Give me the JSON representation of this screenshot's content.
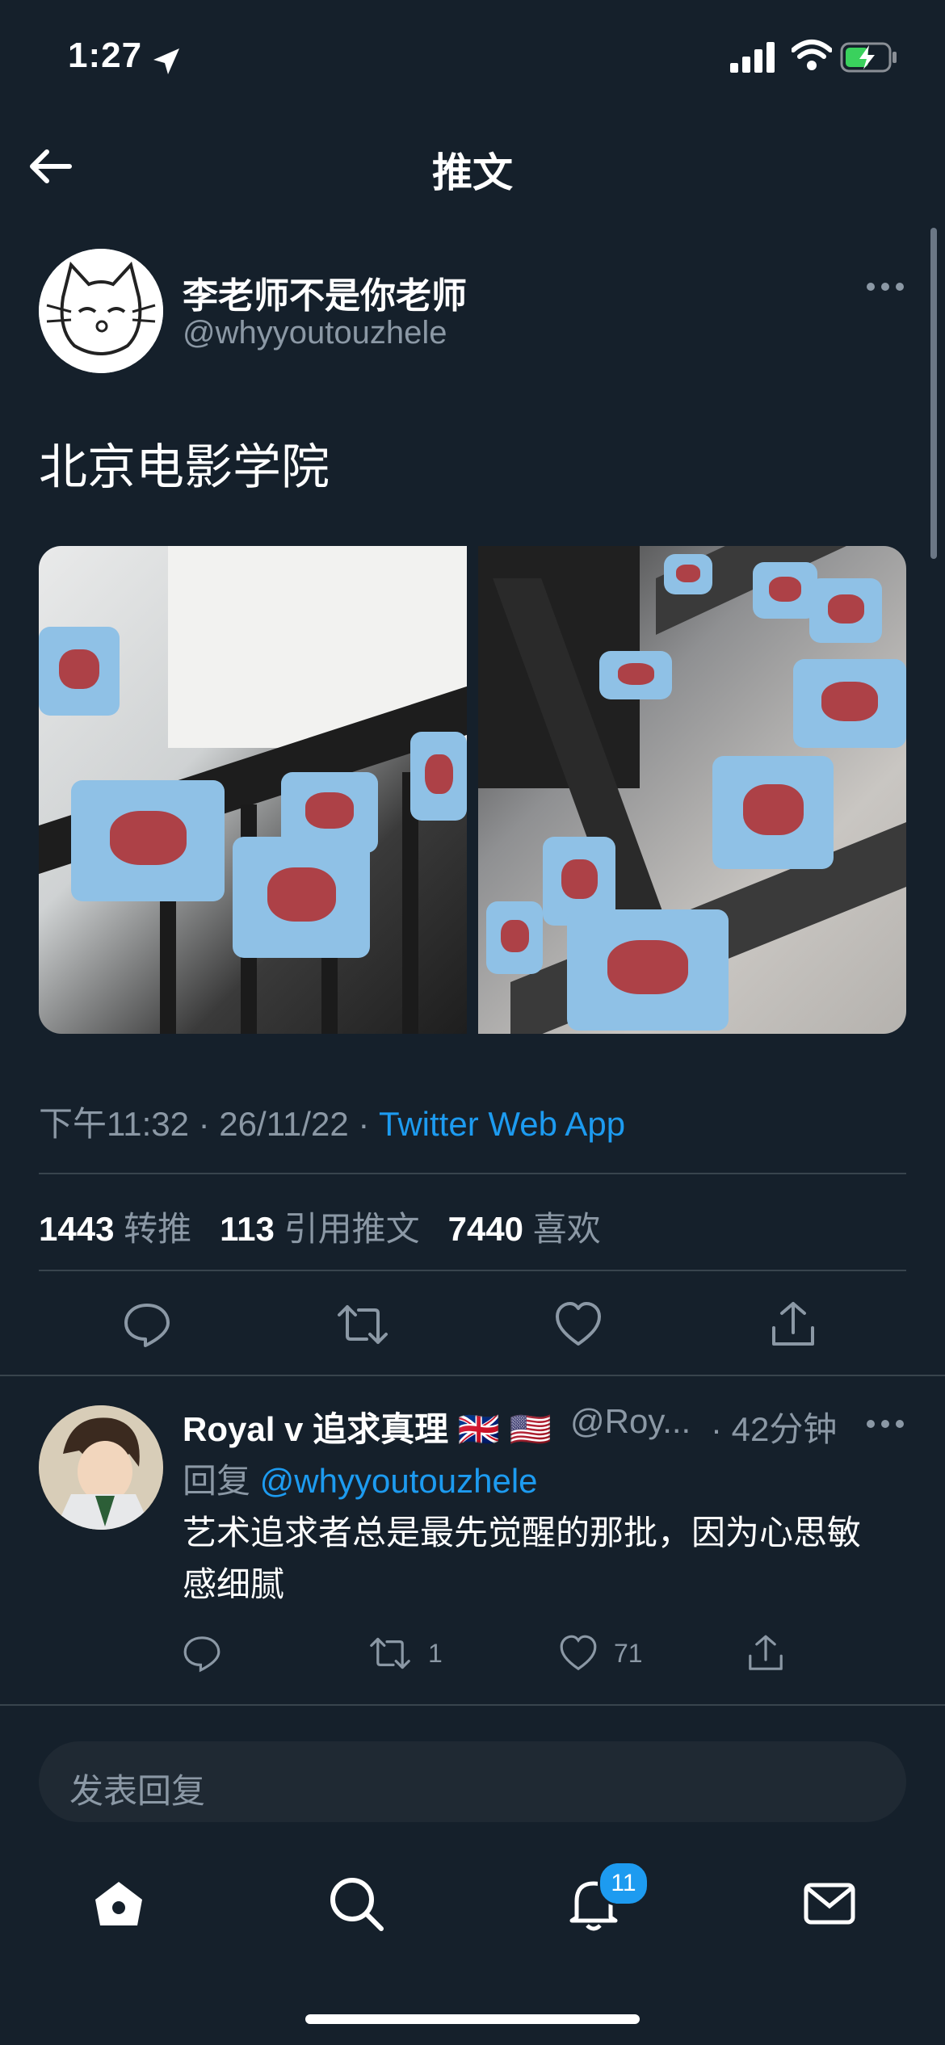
{
  "status_bar": {
    "time": "1:27",
    "battery_color": "#3ad15d"
  },
  "header": {
    "title": "推文",
    "back_icon": "arrow-left-icon"
  },
  "tweet": {
    "author_name": "李老师不是你老师",
    "author_handle": "@whyyoutouzhele",
    "text": "北京电影学院",
    "time": "下午11:32 · 26/11/22 · ",
    "source": "Twitter Web App",
    "stats": {
      "retweets_count": "1443",
      "retweets_label": "转推",
      "quotes_count": "113",
      "quotes_label": "引用推文",
      "likes_count": "7440",
      "likes_label": "喜欢"
    }
  },
  "reply": {
    "name": "Royal v 追求真理",
    "flags": "🇬🇧 🇺🇸",
    "handle": "@Roy...",
    "time": "· 42分钟",
    "replying_label": "回复 ",
    "replying_to": "@whyyoutouzhele",
    "text": "艺术追求者总是最先觉醒的那批，因为心思敏感细腻",
    "retweets": "1",
    "likes": "71"
  },
  "compose": {
    "placeholder": "发表回复"
  },
  "tabbar": {
    "notifications_badge": "11"
  },
  "colors": {
    "background": "#15202b",
    "accent": "#1d9bf0",
    "secondary_text": "#8b98a5",
    "divider": "#38444d"
  }
}
